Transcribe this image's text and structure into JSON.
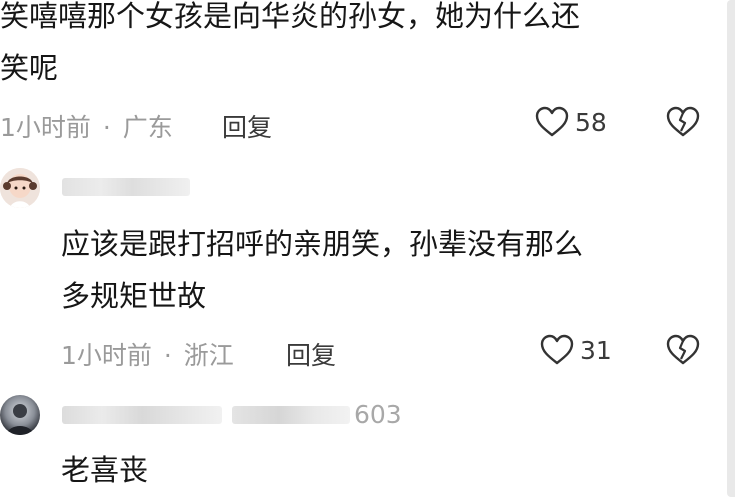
{
  "comments": [
    {
      "text_line1": "笑嘻嘻那个女孩是向华炎的孙女，她为什么还",
      "text_line2": "笑呢",
      "time": "1小时前",
      "location": "广东",
      "reply_label": "回复",
      "likes": "58"
    },
    {
      "text_line1": "应该是跟打招呼的亲朋笑，孙辈没有那么",
      "text_line2": "多规矩世故",
      "time": "1小时前",
      "location": "浙江",
      "reply_label": "回复",
      "likes": "31"
    },
    {
      "username_visible_suffix": "603",
      "text_line1": "老喜丧"
    }
  ],
  "separator": "·",
  "icons": {
    "like": "heart-outline-icon",
    "dislike": "broken-heart-icon"
  },
  "colors": {
    "text": "#161616",
    "meta": "#9a9a9a",
    "icon": "#333333"
  }
}
